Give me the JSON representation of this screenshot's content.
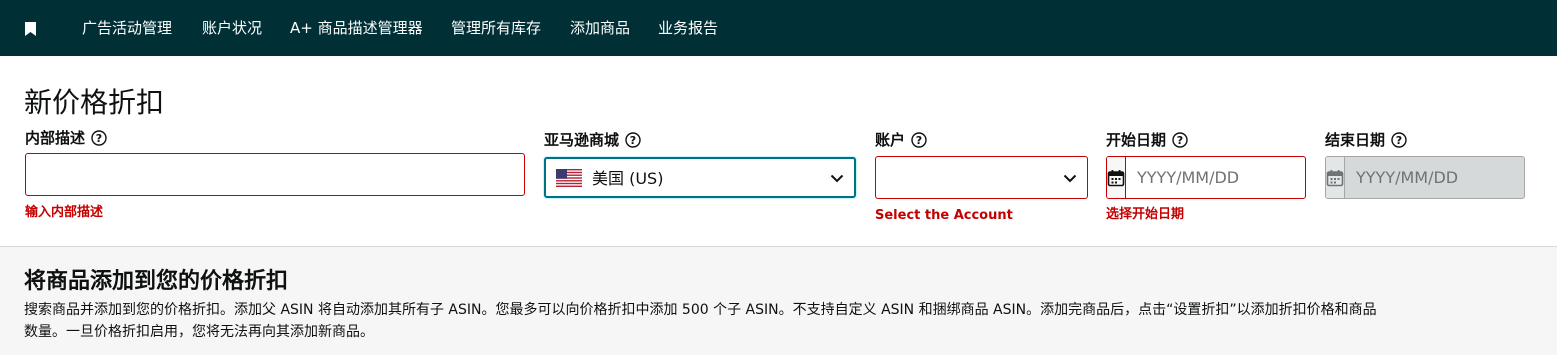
{
  "nav": {
    "bookmark_icon": "bookmark-icon",
    "items": [
      {
        "label": "广告活动管理"
      },
      {
        "label": "账户状况"
      },
      {
        "label": "A+ 商品描述管理器"
      },
      {
        "label": "管理所有库存"
      },
      {
        "label": "添加商品"
      },
      {
        "label": "业务报告"
      }
    ]
  },
  "page": {
    "title": "新价格折扣"
  },
  "form": {
    "internal_description": {
      "label": "内部描述",
      "value": "",
      "error": "输入内部描述"
    },
    "marketplace": {
      "label": "亚马逊商城",
      "value": "美国 (US)",
      "flag_icon": "us-flag-icon"
    },
    "account": {
      "label": "账户",
      "value": "",
      "error": "Select the Account"
    },
    "start_date": {
      "label": "开始日期",
      "placeholder": "YYYY/MM/DD",
      "error": "选择开始日期"
    },
    "end_date": {
      "label": "结束日期",
      "placeholder": "YYYY/MM/DD"
    }
  },
  "add_products": {
    "title": "将商品添加到您的价格折扣",
    "description": "搜索商品并添加到您的价格折扣。添加父 ASIN 将自动添加其所有子 ASIN。您最多可以向价格折扣中添加 500 个子 ASIN。不支持自定义 ASIN 和捆绑商品 ASIN。添加完商品后，点击“设置折扣”以添加折扣价格和商品数量。一旦价格折扣启用，您将无法再向其添加新商品。"
  },
  "colors": {
    "nav_bg": "#002f36",
    "error": "#c40000",
    "focus": "#007185"
  }
}
